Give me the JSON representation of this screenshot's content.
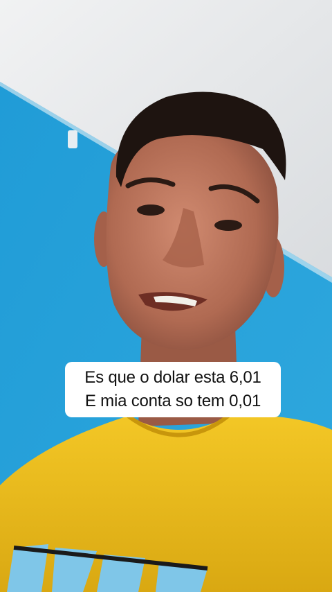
{
  "caption": {
    "line1": "Es que o dolar esta 6,01",
    "line2": "E mia conta so tem 0,01"
  },
  "scene": {
    "description_icon": "selfie-photo",
    "colors": {
      "wall_blue": "#2aa3d8",
      "ceiling": "#e9ecee",
      "shirt": "#f2c21e",
      "skin": "#b8715a",
      "hair": "#1e1410"
    }
  }
}
